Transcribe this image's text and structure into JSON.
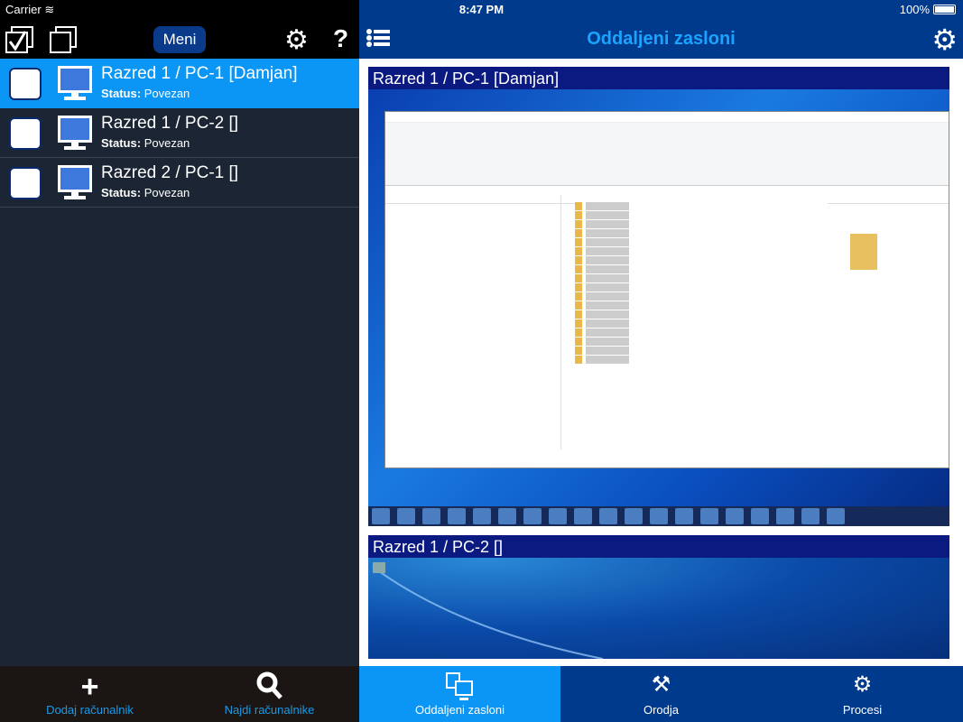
{
  "status_bar": {
    "carrier": "Carrier",
    "time": "8:47 PM",
    "battery": "100%",
    "battery_level": 100
  },
  "left_panel": {
    "menu_label": "Meni",
    "help_label": "?",
    "computers": [
      {
        "name": "Razred 1 / PC-1 [Damjan]",
        "status_label": "Status:",
        "status": "Povezan",
        "selected": true
      },
      {
        "name": "Razred 1 / PC-2 []",
        "status_label": "Status:",
        "status": "Povezan",
        "selected": false
      },
      {
        "name": "Razred 2 / PC-1 []",
        "status_label": "Status:",
        "status": "Povezan",
        "selected": false
      }
    ],
    "actions": [
      {
        "label": "Dodaj računalnik",
        "icon": "plus-icon"
      },
      {
        "label": "Najdi računalnike",
        "icon": "search-icon"
      }
    ]
  },
  "header": {
    "title": "Oddaljeni zasloni"
  },
  "screens": [
    {
      "title": "Razred 1 / PC-1 [Damjan]"
    },
    {
      "title": "Razred 1 / PC-2 []"
    }
  ],
  "tabs": [
    {
      "label": "Oddaljeni zasloni",
      "icon": "monitors-icon",
      "active": true
    },
    {
      "label": "Orodja",
      "icon": "tools-icon",
      "active": false
    },
    {
      "label": "Procesi",
      "icon": "gears-icon",
      "active": false
    }
  ],
  "colors": {
    "accent": "#0b96f5",
    "header": "#003a8c",
    "left_bg": "#1c2533"
  }
}
